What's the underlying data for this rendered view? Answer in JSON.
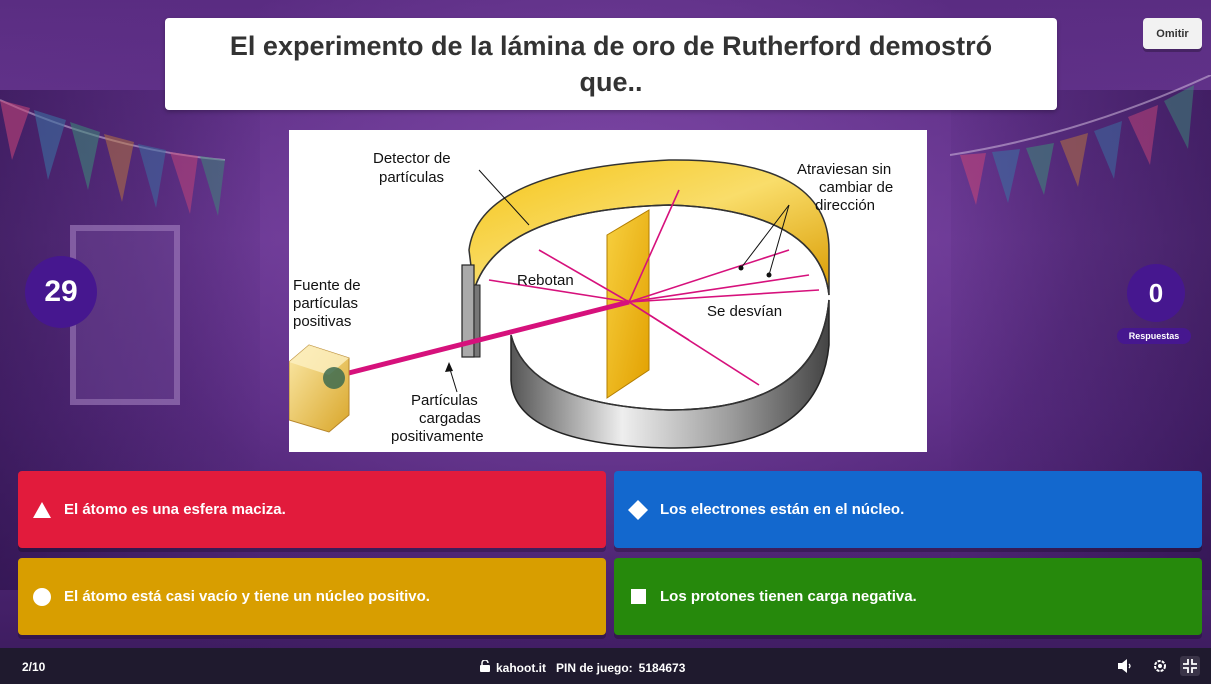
{
  "question": {
    "text": "El experimento de la lámina de oro de Rutherford demostró que.."
  },
  "skip_label": "Omitir",
  "timer": "29",
  "answers_count": {
    "value": "0",
    "label": "Respuestas"
  },
  "diagram": {
    "labels": {
      "detector_1": "Detector de",
      "detector_2": "partículas",
      "atraviesan_1": "Atraviesan sin",
      "atraviesan_2": "cambiar de",
      "atraviesan_3": "dirección",
      "fuente_1": "Fuente de",
      "fuente_2": "partículas",
      "fuente_3": "positivas",
      "rebotan": "Rebotan",
      "desvian": "Se desvían",
      "cargadas_1": "Partículas",
      "cargadas_2": "cargadas",
      "cargadas_3": "positivamente"
    }
  },
  "answers": [
    {
      "shape": "triangle",
      "text": "El átomo es una esfera maciza.",
      "color": "#e21b3c"
    },
    {
      "shape": "diamond",
      "text": "Los electrones están en el núcleo.",
      "color": "#1368ce"
    },
    {
      "shape": "circle",
      "text": "El átomo está casi vacío y tiene un núcleo positivo.",
      "color": "#d89e00"
    },
    {
      "shape": "square",
      "text": "Los protones tienen carga negativa.",
      "color": "#26890c"
    }
  ],
  "footer": {
    "progress": "2/10",
    "site": "kahoot.it",
    "pin_label": "PIN de juego:",
    "pin": "5184673",
    "icons": [
      "lock-icon",
      "volume-icon",
      "settings-icon",
      "fullscreen-exit-icon"
    ]
  },
  "colors": {
    "timer_bg": "#46178f",
    "footer_bg": "#1f1a2e"
  }
}
